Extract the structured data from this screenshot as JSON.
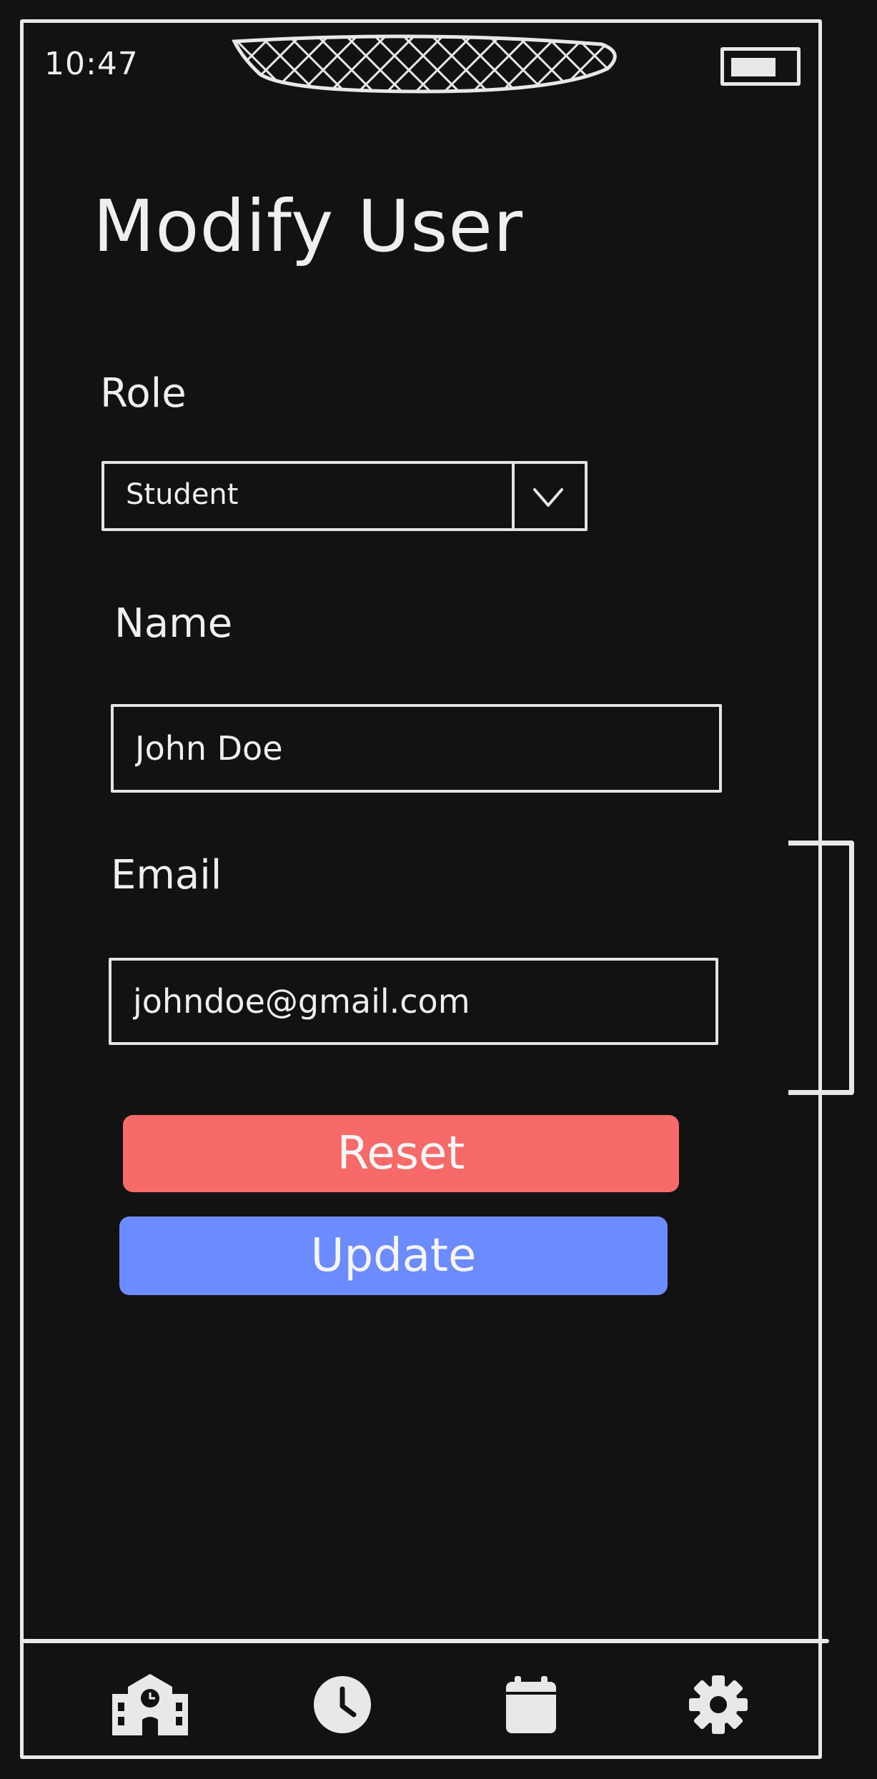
{
  "status_bar": {
    "time": "10:47",
    "notch_icon": "notch",
    "battery_icon": "battery-icon"
  },
  "page": {
    "title": "Modify User"
  },
  "form": {
    "role": {
      "label": "Role",
      "selected": "Student",
      "arrow_icon": "chevron-down-icon"
    },
    "name": {
      "label": "Name",
      "value": "John Doe"
    },
    "email": {
      "label": "Email",
      "value": "johndoe@gmail.com"
    }
  },
  "actions": {
    "reset_label": "Reset",
    "update_label": "Update"
  },
  "bottom_nav": {
    "items": [
      {
        "icon": "school-icon"
      },
      {
        "icon": "clock-icon"
      },
      {
        "icon": "calendar-icon"
      },
      {
        "icon": "gear-icon"
      }
    ]
  },
  "colors": {
    "background": "#121212",
    "stroke": "#e8e8e8",
    "reset": "#f76a6a",
    "update": "#6c8bff"
  }
}
